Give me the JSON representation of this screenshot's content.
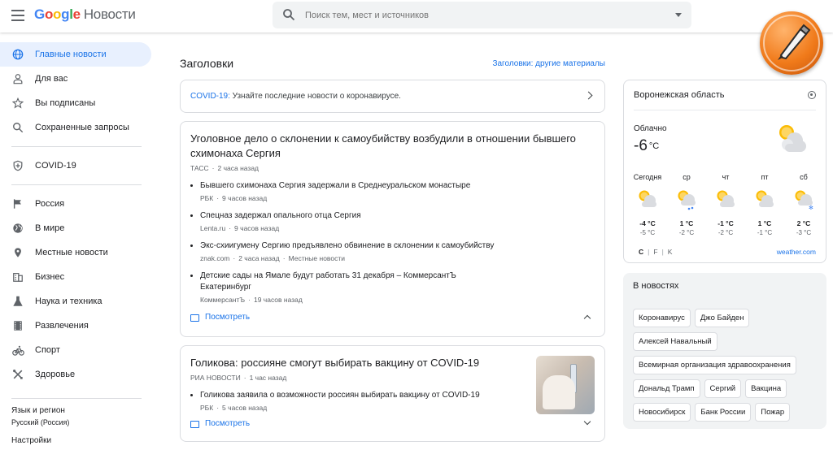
{
  "header": {
    "logo_letters": [
      "G",
      "o",
      "o",
      "g",
      "l",
      "e"
    ],
    "logo_product": "Новости",
    "search_placeholder": "Поиск тем, мест и источников"
  },
  "sidebar": {
    "items": [
      {
        "label": "Главные новости",
        "icon": "globe-icon",
        "active": true
      },
      {
        "label": "Для вас",
        "icon": "person-icon"
      },
      {
        "label": "Вы подписаны",
        "icon": "star-icon"
      },
      {
        "label": "Сохраненные запросы",
        "icon": "search-icon"
      },
      {
        "label": "COVID-19",
        "icon": "shield-icon"
      },
      {
        "label": "Россия",
        "icon": "flag-icon"
      },
      {
        "label": "В мире",
        "icon": "world-icon"
      },
      {
        "label": "Местные новости",
        "icon": "pin-icon"
      },
      {
        "label": "Бизнес",
        "icon": "building-icon"
      },
      {
        "label": "Наука и техника",
        "icon": "flask-icon"
      },
      {
        "label": "Развлечения",
        "icon": "film-icon"
      },
      {
        "label": "Спорт",
        "icon": "bicycle-icon"
      },
      {
        "label": "Здоровье",
        "icon": "tools-icon"
      }
    ],
    "language_label": "Язык и регион",
    "language_value": "Русский (Россия)",
    "settings_label": "Настройки"
  },
  "main": {
    "section_title": "Заголовки",
    "section_more": "Заголовки: другие материалы",
    "covid_banner": {
      "link": "COVID-19:",
      "text": " Узнайте последние новости о коронавирусе."
    },
    "story1": {
      "title": "Уголовное дело о склонении к самоубийству возбудили в отношении бывшего схимонаха Сергия",
      "source": "ТАСС",
      "time": "2 часа назад",
      "subs": [
        {
          "title": "Бывшего схимонаха Сергия задержали в Среднеуральском монастыре",
          "source": "РБК",
          "time": "9 часов назад",
          "extra": ""
        },
        {
          "title": "Спецназ задержал опального отца Сергия",
          "source": "Lenta.ru",
          "time": "9 часов назад",
          "extra": ""
        },
        {
          "title": "Экс-схиигумену Сергию предъявлено обвинение в склонении к самоубийству",
          "source": "znak.com",
          "time": "2 часа назад",
          "extra": "Местные новости"
        },
        {
          "title": "Детские сады на Ямале будут работать 31 декабря – КоммерсантЪ Екатеринбург",
          "source": "КоммерсантЪ",
          "time": "19 часов назад",
          "extra": ""
        }
      ],
      "view_label": "Посмотреть"
    },
    "story2": {
      "title": "Голикова: россияне смогут выбирать вакцину от COVID-19",
      "source": "РИА НОВОСТИ",
      "time": "1 час назад",
      "subs": [
        {
          "title": "Голикова заявила о возможности россиян выбирать вакцину от COVID-19",
          "source": "РБК",
          "time": "5 часов назад"
        }
      ],
      "view_label": "Посмотреть"
    }
  },
  "weather": {
    "region": "Воронежская область",
    "condition": "Облачно",
    "temp": "-6",
    "unit": "°C",
    "days": [
      {
        "name": "Сегодня",
        "hi": "-4 °C",
        "lo": "-5 °C"
      },
      {
        "name": "ср",
        "hi": "1 °C",
        "lo": "-2 °C"
      },
      {
        "name": "чт",
        "hi": "-1 °C",
        "lo": "-2 °C"
      },
      {
        "name": "пт",
        "hi": "1 °C",
        "lo": "-1 °C"
      },
      {
        "name": "сб",
        "hi": "2 °C",
        "lo": "-3 °C"
      }
    ],
    "units": [
      "C",
      "F",
      "K"
    ],
    "source": "weather.com"
  },
  "in_news": {
    "title": "В новостях",
    "chips": [
      "Коронавирус",
      "Джо Байден",
      "Алексей Навальный",
      "Всемирная организация здравоохранения",
      "Дональд Трамп",
      "Сергий",
      "Вакцина",
      "Новосибирск",
      "Банк России",
      "Пожар"
    ]
  }
}
